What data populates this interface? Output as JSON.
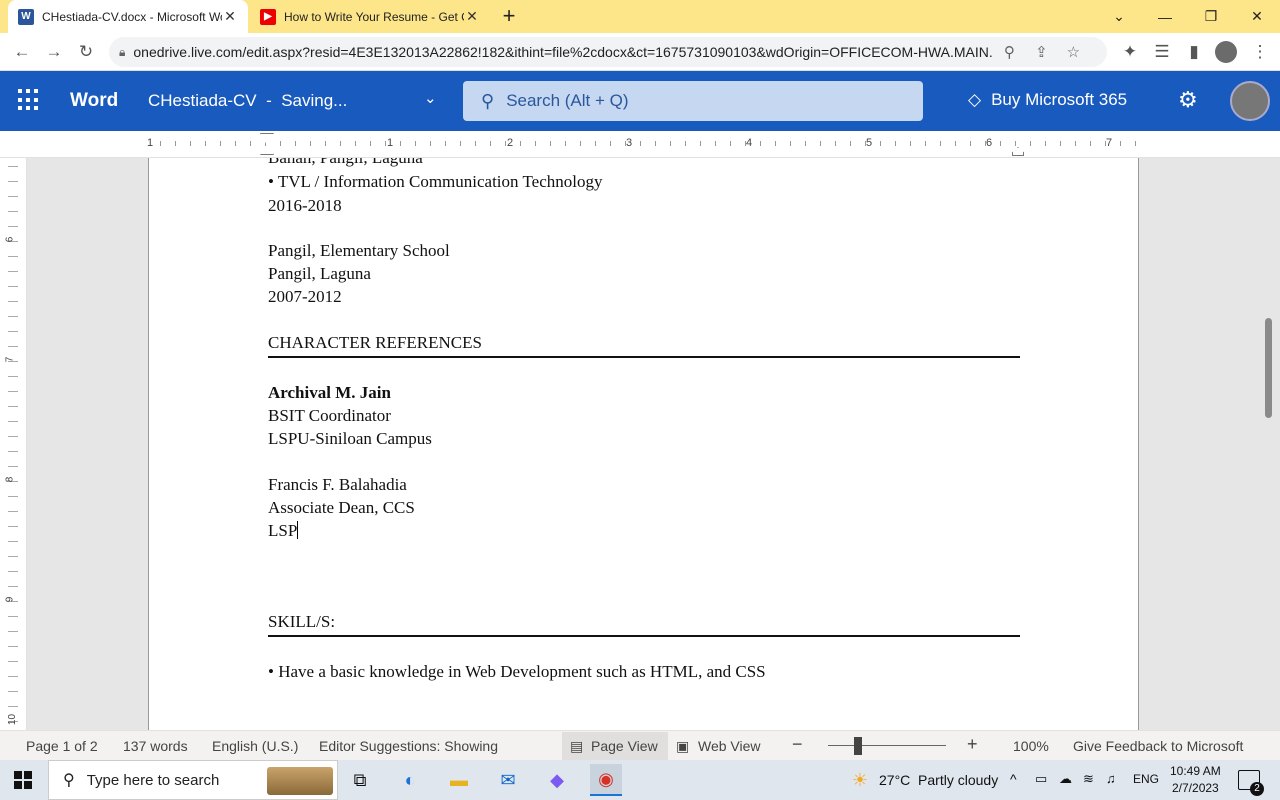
{
  "browser": {
    "tabs": [
      {
        "title": "CHestiada-CV.docx - Microsoft Word",
        "icon": "word-favicon",
        "active": true
      },
      {
        "title": "How to Write Your Resume - Get Career Tips",
        "icon": "youtube-favicon",
        "active": false
      }
    ],
    "new_tab": "+",
    "url": "onedrive.live.com/edit.aspx?resid=4E3E132013A22862!182&ithint=file%2cdocx&ct=1675731090103&wdOrigin=OFFICECOM-HWA.MAIN...."
  },
  "word": {
    "app_name": "Word",
    "doc_title": "CHestiada-CV  -  Saving...",
    "search_placeholder": "Search (Alt + Q)",
    "buy_label": "Buy Microsoft 365",
    "header_color": "#185abd"
  },
  "ruler": {
    "numbers": [
      "1",
      "1",
      "2",
      "3",
      "4",
      "5",
      "6",
      "7"
    ]
  },
  "vruler": {
    "numbers": [
      "6",
      "7",
      "8",
      "9",
      "10"
    ]
  },
  "document": {
    "lines": {
      "cut": "Bahan, Pangil, Laguna",
      "tvl": "• TVL / Information Communication Technology",
      "tvl_years": "2016-2018",
      "elem": "Pangil, Elementary School",
      "elem_addr": "Pangil, Laguna",
      "elem_years": "2007-2012",
      "refs_heading": "CHARACTER REFERENCES",
      "ref1_name": "Archival M. Jain",
      "ref1_title": "BSIT Coordinator",
      "ref1_org": "LSPU-Siniloan Campus",
      "ref2_name": "Francis F. Balahadia",
      "ref2_title": "Associate Dean, CCS",
      "ref2_org": "LSP",
      "skills_heading": "SKILL/S:",
      "skill1": "• Have a basic knowledge in Web Development such as HTML, and CSS"
    }
  },
  "status": {
    "page": "Page 1 of 2",
    "words": "137 words",
    "language": "English (U.S.)",
    "editor": "Editor Suggestions: Showing",
    "page_view": "Page View",
    "web_view": "Web View",
    "zoom": "100%",
    "feedback": "Give Feedback to Microsoft",
    "zoom_level": 0.22
  },
  "taskbar": {
    "search_placeholder": "Type here to search",
    "weather": "27°C  Partly cloudy",
    "lang": "ENG",
    "time": "10:49 AM",
    "date": "2/7/2023",
    "notifications": "2"
  }
}
